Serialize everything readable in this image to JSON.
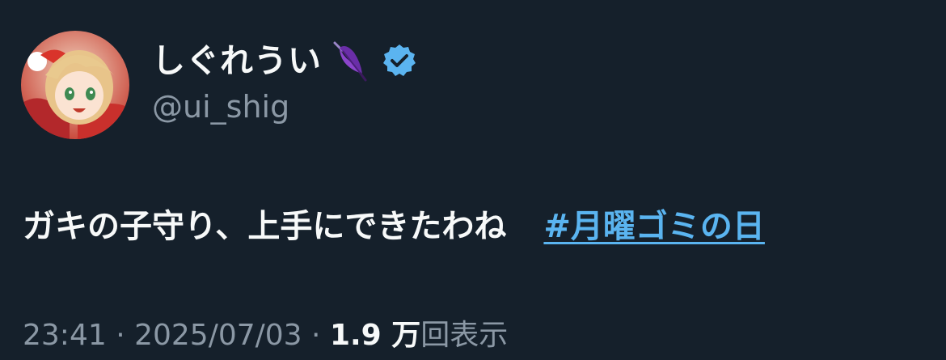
{
  "author": {
    "display_name": "しぐれうい",
    "handle": "@ui_shig",
    "name_emoji": "umbrella-icon",
    "verified": true,
    "verified_color": "#5bb4f0"
  },
  "tweet": {
    "text": "ガキの子守り、上手にできたわね",
    "hashtag": "#月曜ゴミの日"
  },
  "meta": {
    "time": "23:41",
    "separator": " · ",
    "date": "2025/07/03",
    "views_count": "1.9 万",
    "views_label": "回表示"
  },
  "colors": {
    "background": "#15202b",
    "text": "#f7f9f9",
    "secondary": "#8b98a5",
    "link": "#5ab4f0"
  }
}
